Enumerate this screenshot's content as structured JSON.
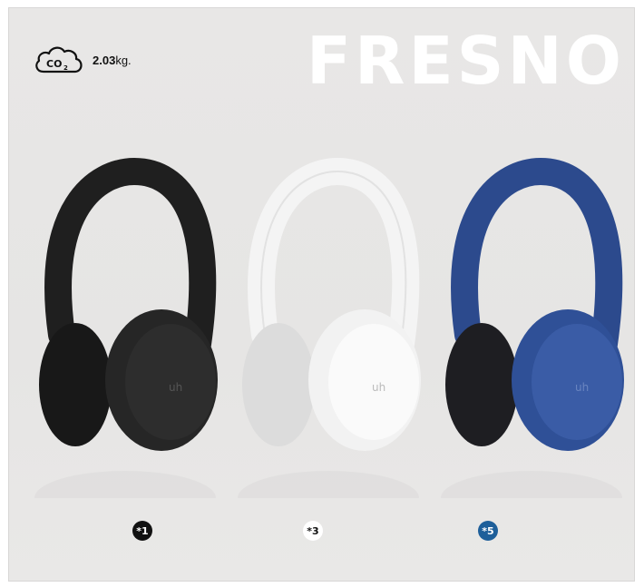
{
  "co2": {
    "icon": "co2-cloud-icon",
    "amount": "2.03",
    "unit": "kg."
  },
  "title": "FRESNO",
  "variants": [
    {
      "code": "*1",
      "color": "#1c1c1c",
      "badge_bg": "#111111",
      "badge_fg": "#ffffff"
    },
    {
      "code": "*3",
      "color": "#f3f3f3",
      "badge_bg": "#ffffff",
      "badge_fg": "#111111"
    },
    {
      "code": "*5",
      "color": "#2e4f95",
      "badge_bg": "#1e5f9a",
      "badge_fg": "#ffffff"
    }
  ]
}
